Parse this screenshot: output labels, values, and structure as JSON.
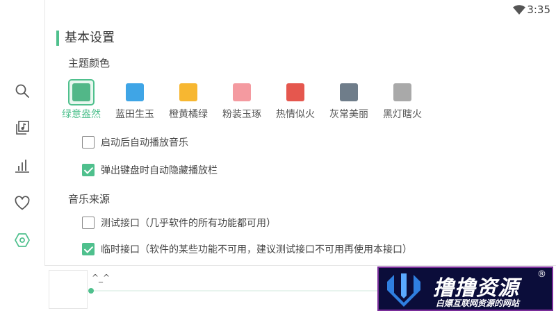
{
  "status_bar": {
    "time": "3:35"
  },
  "sidebar": {
    "items": [
      {
        "icon": "search-icon"
      },
      {
        "icon": "music-library-icon"
      },
      {
        "icon": "chart-icon"
      },
      {
        "icon": "heart-icon"
      },
      {
        "icon": "settings-icon",
        "active": true
      }
    ]
  },
  "settings": {
    "section_title": "基本设置",
    "theme_heading": "主题颜色",
    "themes": [
      {
        "label": "绿意盎然",
        "color": "#52b788",
        "selected": true
      },
      {
        "label": "蓝田生玉",
        "color": "#3fa5e6"
      },
      {
        "label": "橙黄橘绿",
        "color": "#f7b731"
      },
      {
        "label": "粉装玉琢",
        "color": "#f49aa0"
      },
      {
        "label": "热情似火",
        "color": "#e5574e"
      },
      {
        "label": "灰常美丽",
        "color": "#6f7d8a"
      },
      {
        "label": "黑灯瞎火",
        "color": "#a9a9a9"
      }
    ],
    "options": [
      {
        "label": "启动后自动播放音乐",
        "checked": false
      },
      {
        "label": "弹出键盘时自动隐藏播放栏",
        "checked": true
      }
    ],
    "source_heading": "音乐来源",
    "sources": [
      {
        "label": "测试接口（几乎软件的所有功能都可用）",
        "checked": false
      },
      {
        "label": "临时接口（软件的某些功能不可用，建议测试接口不可用再使用本接口）",
        "checked": true
      }
    ]
  },
  "player": {
    "title": "^_^"
  },
  "watermark": {
    "title": "撸撸资源",
    "registered": "®",
    "subtitle": "白嫖互联网资源的网站"
  },
  "colors": {
    "accent": "#4fc08d",
    "watermark_bg": "#0b0d3a",
    "watermark_border": "#7a2d9a"
  }
}
